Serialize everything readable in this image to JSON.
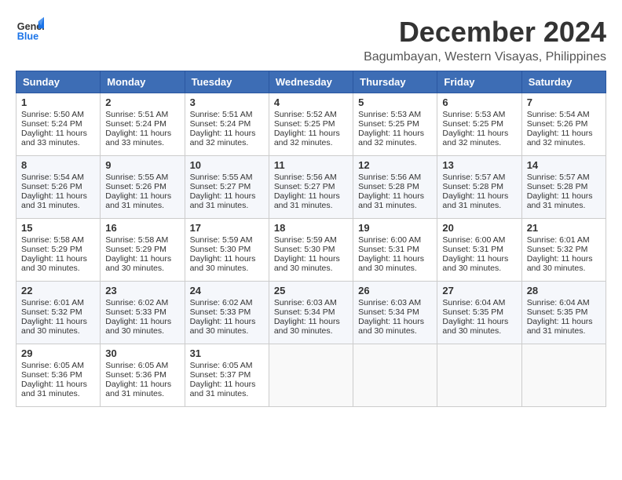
{
  "header": {
    "logo_line1": "General",
    "logo_line2": "Blue",
    "month_title": "December 2024",
    "location": "Bagumbayan, Western Visayas, Philippines"
  },
  "days_of_week": [
    "Sunday",
    "Monday",
    "Tuesday",
    "Wednesday",
    "Thursday",
    "Friday",
    "Saturday"
  ],
  "weeks": [
    [
      {
        "day": "1",
        "sunrise": "5:50 AM",
        "sunset": "5:24 PM",
        "daylight": "11 hours and 33 minutes."
      },
      {
        "day": "2",
        "sunrise": "5:51 AM",
        "sunset": "5:24 PM",
        "daylight": "11 hours and 33 minutes."
      },
      {
        "day": "3",
        "sunrise": "5:51 AM",
        "sunset": "5:24 PM",
        "daylight": "11 hours and 32 minutes."
      },
      {
        "day": "4",
        "sunrise": "5:52 AM",
        "sunset": "5:25 PM",
        "daylight": "11 hours and 32 minutes."
      },
      {
        "day": "5",
        "sunrise": "5:53 AM",
        "sunset": "5:25 PM",
        "daylight": "11 hours and 32 minutes."
      },
      {
        "day": "6",
        "sunrise": "5:53 AM",
        "sunset": "5:25 PM",
        "daylight": "11 hours and 32 minutes."
      },
      {
        "day": "7",
        "sunrise": "5:54 AM",
        "sunset": "5:26 PM",
        "daylight": "11 hours and 32 minutes."
      }
    ],
    [
      {
        "day": "8",
        "sunrise": "5:54 AM",
        "sunset": "5:26 PM",
        "daylight": "11 hours and 31 minutes."
      },
      {
        "day": "9",
        "sunrise": "5:55 AM",
        "sunset": "5:26 PM",
        "daylight": "11 hours and 31 minutes."
      },
      {
        "day": "10",
        "sunrise": "5:55 AM",
        "sunset": "5:27 PM",
        "daylight": "11 hours and 31 minutes."
      },
      {
        "day": "11",
        "sunrise": "5:56 AM",
        "sunset": "5:27 PM",
        "daylight": "11 hours and 31 minutes."
      },
      {
        "day": "12",
        "sunrise": "5:56 AM",
        "sunset": "5:28 PM",
        "daylight": "11 hours and 31 minutes."
      },
      {
        "day": "13",
        "sunrise": "5:57 AM",
        "sunset": "5:28 PM",
        "daylight": "11 hours and 31 minutes."
      },
      {
        "day": "14",
        "sunrise": "5:57 AM",
        "sunset": "5:28 PM",
        "daylight": "11 hours and 31 minutes."
      }
    ],
    [
      {
        "day": "15",
        "sunrise": "5:58 AM",
        "sunset": "5:29 PM",
        "daylight": "11 hours and 30 minutes."
      },
      {
        "day": "16",
        "sunrise": "5:58 AM",
        "sunset": "5:29 PM",
        "daylight": "11 hours and 30 minutes."
      },
      {
        "day": "17",
        "sunrise": "5:59 AM",
        "sunset": "5:30 PM",
        "daylight": "11 hours and 30 minutes."
      },
      {
        "day": "18",
        "sunrise": "5:59 AM",
        "sunset": "5:30 PM",
        "daylight": "11 hours and 30 minutes."
      },
      {
        "day": "19",
        "sunrise": "6:00 AM",
        "sunset": "5:31 PM",
        "daylight": "11 hours and 30 minutes."
      },
      {
        "day": "20",
        "sunrise": "6:00 AM",
        "sunset": "5:31 PM",
        "daylight": "11 hours and 30 minutes."
      },
      {
        "day": "21",
        "sunrise": "6:01 AM",
        "sunset": "5:32 PM",
        "daylight": "11 hours and 30 minutes."
      }
    ],
    [
      {
        "day": "22",
        "sunrise": "6:01 AM",
        "sunset": "5:32 PM",
        "daylight": "11 hours and 30 minutes."
      },
      {
        "day": "23",
        "sunrise": "6:02 AM",
        "sunset": "5:33 PM",
        "daylight": "11 hours and 30 minutes."
      },
      {
        "day": "24",
        "sunrise": "6:02 AM",
        "sunset": "5:33 PM",
        "daylight": "11 hours and 30 minutes."
      },
      {
        "day": "25",
        "sunrise": "6:03 AM",
        "sunset": "5:34 PM",
        "daylight": "11 hours and 30 minutes."
      },
      {
        "day": "26",
        "sunrise": "6:03 AM",
        "sunset": "5:34 PM",
        "daylight": "11 hours and 30 minutes."
      },
      {
        "day": "27",
        "sunrise": "6:04 AM",
        "sunset": "5:35 PM",
        "daylight": "11 hours and 30 minutes."
      },
      {
        "day": "28",
        "sunrise": "6:04 AM",
        "sunset": "5:35 PM",
        "daylight": "11 hours and 31 minutes."
      }
    ],
    [
      {
        "day": "29",
        "sunrise": "6:05 AM",
        "sunset": "5:36 PM",
        "daylight": "11 hours and 31 minutes."
      },
      {
        "day": "30",
        "sunrise": "6:05 AM",
        "sunset": "5:36 PM",
        "daylight": "11 hours and 31 minutes."
      },
      {
        "day": "31",
        "sunrise": "6:05 AM",
        "sunset": "5:37 PM",
        "daylight": "11 hours and 31 minutes."
      },
      null,
      null,
      null,
      null
    ]
  ],
  "labels": {
    "sunrise": "Sunrise:",
    "sunset": "Sunset:",
    "daylight": "Daylight:"
  }
}
